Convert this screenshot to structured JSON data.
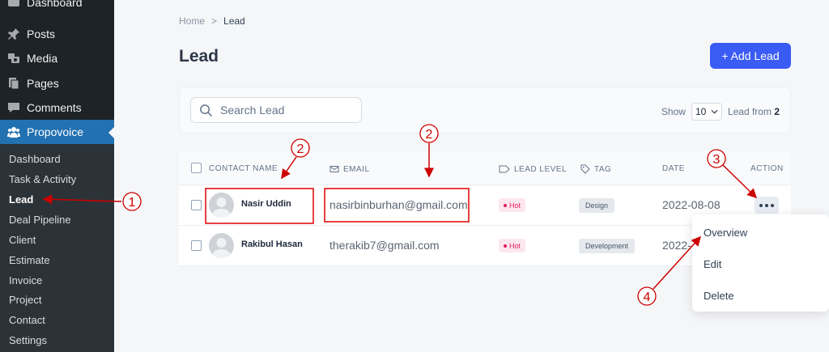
{
  "sidebar": {
    "top_items": [
      {
        "label": "Dashboard",
        "icon": "dashboard-icon"
      },
      {
        "label": "Posts",
        "icon": "pin-icon"
      },
      {
        "label": "Media",
        "icon": "media-icon"
      },
      {
        "label": "Pages",
        "icon": "pages-icon"
      },
      {
        "label": "Comments",
        "icon": "comment-icon"
      },
      {
        "label": "Propovoice",
        "icon": "users-icon"
      }
    ],
    "sub_items": [
      "Dashboard",
      "Task & Activity",
      "Lead",
      "Deal Pipeline",
      "Client",
      "Estimate",
      "Invoice",
      "Project",
      "Contact",
      "Settings"
    ],
    "active_sub": "Lead"
  },
  "breadcrumb": {
    "home": "Home",
    "separator": ">",
    "current": "Lead"
  },
  "page": {
    "title": "Lead",
    "add_button": "+ Add Lead"
  },
  "filter": {
    "search_placeholder": "Search Lead",
    "show_label": "Show",
    "page_size": "10",
    "lead_from_label": "Lead from",
    "lead_count": "2"
  },
  "table": {
    "headers": {
      "contact_name": "CONTACT NAME",
      "email": "EMAIL",
      "lead_level": "LEAD LEVEL",
      "tag": "TAG",
      "date": "DATE",
      "action": "ACTION"
    },
    "rows": [
      {
        "name": "Nasir Uddin",
        "email": "nasirbinburhan@gmail.com",
        "level": "Hot",
        "tag": "Design",
        "date": "2022-08-08"
      },
      {
        "name": "Rakibul Hasan",
        "email": "therakib7@gmail.com",
        "level": "Hot",
        "tag": "Development",
        "date": "2022-"
      }
    ]
  },
  "action_menu": {
    "items": [
      "Overview",
      "Edit",
      "Delete"
    ]
  },
  "callouts": [
    "1",
    "2",
    "2",
    "3",
    "4"
  ],
  "colors": {
    "sidebar_bg": "#1d2327",
    "active_menu": "#2271b1",
    "primary_button": "#3b5bf5",
    "hot_badge": "#e11d5a",
    "annotation": "#cc0000"
  }
}
